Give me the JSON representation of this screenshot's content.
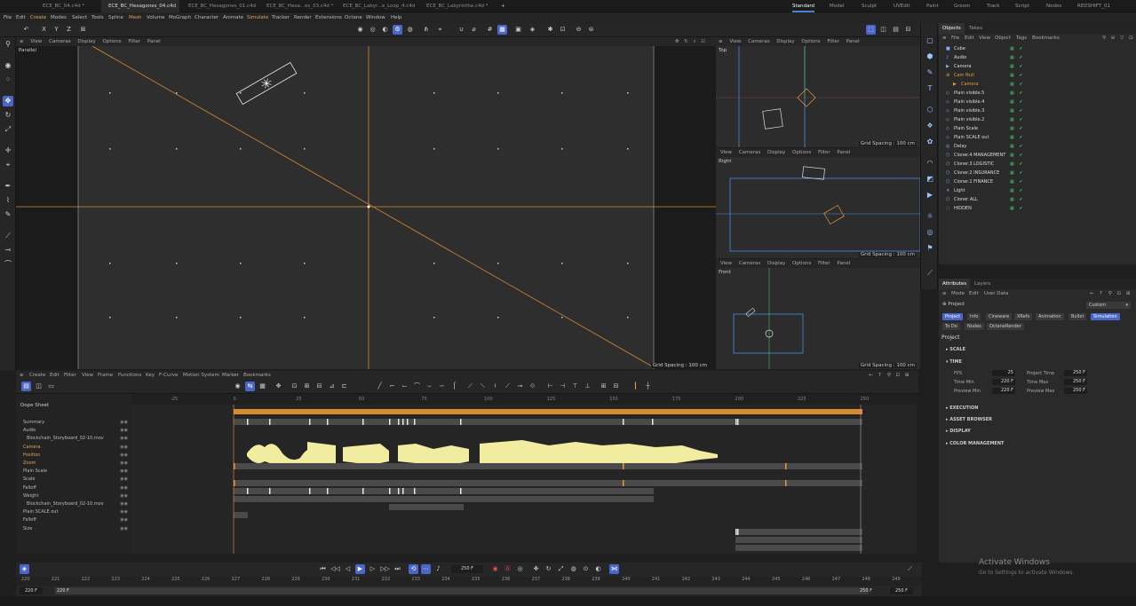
{
  "tabs": [
    {
      "label": "ECE_BC_04.c4d *",
      "active": false
    },
    {
      "label": "ECE_BC_Hexagones_04.c4d",
      "active": true
    },
    {
      "label": "ECE_BC_Hexagones_01.c4d",
      "active": false
    },
    {
      "label": "ECE_BC_Hexa...es_03.c4d *",
      "active": false
    },
    {
      "label": "ECE_BC_Labyr...e_Loop_4.c4d",
      "active": false
    },
    {
      "label": "ECE_BC_Labyrinthe.c4d *",
      "active": false
    }
  ],
  "layouts": [
    "Standard",
    "Model",
    "Sculpt",
    "UVEdit",
    "Paint",
    "Groom",
    "Track",
    "Script",
    "Nodes",
    "REDSHIFT_01"
  ],
  "menu": [
    "File",
    "Edit",
    "Create",
    "Modes",
    "Select",
    "Tools",
    "Spline",
    "Mesh",
    "Volume",
    "MoGraph",
    "Character",
    "Animate",
    "Simulate",
    "Tracker",
    "Render",
    "Extensions",
    "Octane",
    "Window",
    "Help"
  ],
  "axis_buttons": [
    "X",
    "Y",
    "Z"
  ],
  "viewport_menu": [
    "View",
    "Cameras",
    "Display",
    "Options",
    "Filter",
    "Panel"
  ],
  "viewports": {
    "main": {
      "label": "Parallel",
      "grid": "Grid Spacing : 100 cm"
    },
    "top": {
      "label": "Top",
      "grid": "Grid Spacing : 100 cm"
    },
    "right": {
      "label": "Right",
      "grid": "Grid Spacing : 100 cm"
    },
    "front": {
      "label": "Front",
      "grid": "Grid Spacing : 100 cm"
    }
  },
  "objects_panel": {
    "tabs": [
      "Objects",
      "Takes"
    ],
    "menu": [
      "File",
      "Edit",
      "View",
      "Object",
      "Tags",
      "Bookmarks"
    ],
    "rows": [
      {
        "name": "Cube",
        "color": "#ddd",
        "indent": 0,
        "icon": "■"
      },
      {
        "name": "Audio",
        "color": "#ddd",
        "indent": 0,
        "icon": "♪"
      },
      {
        "name": "Camera",
        "color": "#ddd",
        "indent": 0,
        "icon": "▶"
      },
      {
        "name": "Cam Null",
        "color": "#e89a3a",
        "indent": 0,
        "icon": "⊕"
      },
      {
        "name": "Camera",
        "color": "#e89a3a",
        "indent": 1,
        "icon": "▶"
      },
      {
        "name": "Plain visible.5",
        "color": "#ddd",
        "indent": 0,
        "icon": "◇"
      },
      {
        "name": "Plain visible.4",
        "color": "#ddd",
        "indent": 0,
        "icon": "◇"
      },
      {
        "name": "Plain visible.3",
        "color": "#ddd",
        "indent": 0,
        "icon": "◇"
      },
      {
        "name": "Plain visible.2",
        "color": "#ddd",
        "indent": 0,
        "icon": "◇"
      },
      {
        "name": "Plain Scale",
        "color": "#ddd",
        "indent": 0,
        "icon": "◇"
      },
      {
        "name": "Plain SCALE out",
        "color": "#ddd",
        "indent": 0,
        "icon": "◇"
      },
      {
        "name": "Delay",
        "color": "#ddd",
        "indent": 0,
        "icon": "◎"
      },
      {
        "name": "Cloner.4 MANAGEMENT",
        "color": "#ddd",
        "indent": 0,
        "icon": "⬡"
      },
      {
        "name": "Cloner.3 LOGISTIC",
        "color": "#ddd",
        "indent": 0,
        "icon": "⬡"
      },
      {
        "name": "Cloner.2 INSURANCE",
        "color": "#ddd",
        "indent": 0,
        "icon": "⬡"
      },
      {
        "name": "Cloner.1 FINANCE",
        "color": "#ddd",
        "indent": 0,
        "icon": "⬡"
      },
      {
        "name": "Light",
        "color": "#ddd",
        "indent": 0,
        "icon": "☀"
      },
      {
        "name": "Cloner ALL",
        "color": "#ddd",
        "indent": 0,
        "icon": "⬡"
      },
      {
        "name": "HIDDEN",
        "color": "#ddd",
        "indent": 0,
        "icon": "◌"
      }
    ]
  },
  "attributes": {
    "tabs": [
      "Attributes",
      "Layers"
    ],
    "menu": [
      "Mode",
      "Edit",
      "User Data"
    ],
    "context": "Project",
    "preset": "Custom",
    "buttons_row1": [
      "Project",
      "Info",
      "Cineware",
      "XRefs",
      "Animation",
      "Bullet",
      "Simulation"
    ],
    "buttons_row2": [
      "To Do",
      "Nodes",
      "OctaneRender"
    ],
    "heading": "Project",
    "sections": [
      "SCALE",
      "TIME",
      "EXECUTION",
      "ASSET BROWSER",
      "DISPLAY",
      "COLOR MANAGEMENT"
    ],
    "time": {
      "fps_label": "FPS",
      "fps": "25",
      "project_time_label": "Project Time",
      "project_time": "250 F",
      "time_min_label": "Time Min",
      "time_min": "220 F",
      "time_max_label": "Time Max",
      "time_max": "250 F",
      "preview_min_label": "Preview Min",
      "preview_min": "220 F",
      "preview_max_label": "Preview Max",
      "preview_max": "250 F"
    }
  },
  "dopesheet": {
    "menu": [
      "Create",
      "Edit",
      "Filter",
      "View",
      "Frame",
      "Functions",
      "Key",
      "F-Curve",
      "Motion System",
      "Marker",
      "Bookmarks"
    ],
    "title": "Dope Sheet",
    "ruler": [
      "-25",
      "0",
      "25",
      "50",
      "75",
      "100",
      "125",
      "150",
      "175",
      "200",
      "225",
      "250"
    ],
    "tree": [
      {
        "label": "Summary",
        "orange": false
      },
      {
        "label": "Audio",
        "orange": false
      },
      {
        "label": "Blockchain_Storyboard_02-10.mov",
        "orange": false
      },
      {
        "label": "Camera",
        "orange": true
      },
      {
        "label": "Position",
        "orange": true
      },
      {
        "label": "Zoom",
        "orange": true
      },
      {
        "label": "Plain Scale",
        "orange": false
      },
      {
        "label": "Scale",
        "orange": false
      },
      {
        "label": "Falloff",
        "orange": false
      },
      {
        "label": "Weight",
        "orange": false
      },
      {
        "label": "Blockchain_Storyboard_02-10.mov",
        "orange": false
      },
      {
        "label": "Plain SCALE out",
        "orange": false
      },
      {
        "label": "Falloff",
        "orange": false
      },
      {
        "label": "Size",
        "orange": false
      }
    ]
  },
  "transport": {
    "current": "250 F"
  },
  "bottom_ruler": [
    "220",
    "221",
    "222",
    "223",
    "224",
    "225",
    "226",
    "227",
    "228",
    "229",
    "230",
    "231",
    "232",
    "233",
    "234",
    "235",
    "236",
    "237",
    "238",
    "239",
    "240",
    "241",
    "242",
    "243",
    "244",
    "245",
    "246",
    "247",
    "248",
    "249"
  ],
  "range": {
    "start_a": "220 F",
    "start_b": "220 F",
    "end_a": "250 F",
    "end_b": "250 F"
  },
  "watermark": {
    "line1": "Activate Windows",
    "line2": "Go to Settings to activate Windows."
  },
  "colors": {
    "accent": "#4a66c9",
    "orange": "#e89a3a",
    "green": "#3ec06b",
    "audio": "#f1eca0"
  }
}
